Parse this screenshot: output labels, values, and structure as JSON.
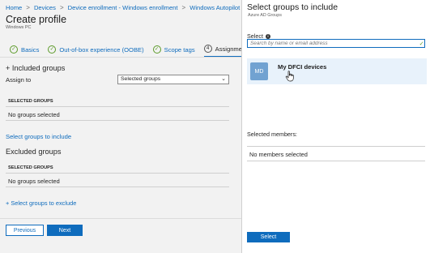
{
  "breadcrumb": {
    "items": [
      "Home",
      "Devices",
      "Device enrollment - Windows enrollment",
      "Windows Autopilot dep"
    ],
    "separator": ">"
  },
  "profile": {
    "title": "Create profile",
    "subtitle": "Windows PC"
  },
  "tabs": [
    {
      "label": "Basics",
      "state": "complete"
    },
    {
      "label": "Out-of-box experience (OOBE)",
      "state": "complete"
    },
    {
      "label": "Scope tags",
      "state": "complete"
    },
    {
      "label": "Assignment",
      "number": "4",
      "state": "active"
    }
  ],
  "assignments": {
    "included_heading": "+ Included groups",
    "assign_to_label": "Assign to",
    "assign_to_value": "Selected groups",
    "included_table_header": "SELECTED GROUPS",
    "included_empty": "No groups selected",
    "select_include_link": "Select groups to include",
    "excluded_heading": "Excluded groups",
    "excluded_table_header": "SELECTED GROUPS",
    "excluded_empty": "No groups selected",
    "select_exclude_link": "+ Select groups to exclude"
  },
  "footer": {
    "previous_label": "Previous",
    "next_label": "Next"
  },
  "pane": {
    "title": "Select groups to include",
    "subtitle": "Azure AD Groups",
    "select_label": "Select",
    "search_placeholder": "Search by name or email address",
    "results": [
      {
        "initials": "MD",
        "name": "My DFCI devices"
      }
    ],
    "selected_members_label": "Selected members:",
    "no_members": "No members selected",
    "select_button": "Select"
  },
  "colors": {
    "accent": "#0f6cbd",
    "check": "#5b9a28",
    "avatar": "#71a2d1",
    "row_highlight": "#e8f2fb"
  }
}
